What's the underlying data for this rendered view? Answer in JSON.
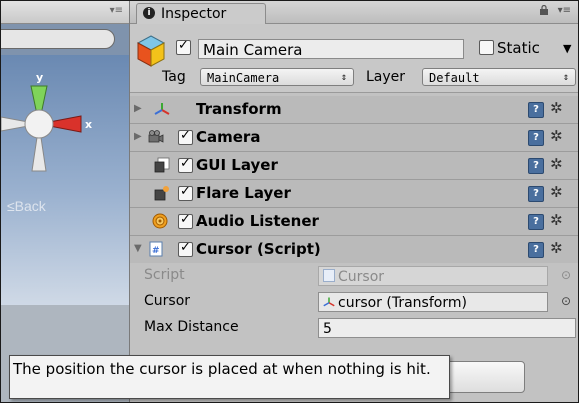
{
  "scene": {
    "menu_glyph": "▾≡",
    "back_label": "≤Back",
    "gizmo_y_label": "y",
    "gizmo_x_label": "x"
  },
  "inspector": {
    "tab_label": "Inspector",
    "tab_icon_glyph": "i",
    "menu_glyph": "▾≡",
    "object_name": "Main Camera",
    "object_enabled": true,
    "static_label": "Static",
    "static_checked": false,
    "static_arrow": "▼",
    "tag_label": "Tag",
    "tag_value": "MainCamera",
    "layer_label": "Layer",
    "layer_value": "Default",
    "dropdown_arrows": "⇕"
  },
  "components": [
    {
      "name": "Transform",
      "has_checkbox": false,
      "icon": "transform-icon"
    },
    {
      "name": "Camera",
      "has_checkbox": true,
      "icon": "camera-icon"
    },
    {
      "name": "GUI Layer",
      "has_checkbox": true,
      "icon": "gui-layer-icon"
    },
    {
      "name": "Flare Layer",
      "has_checkbox": true,
      "icon": "flare-layer-icon"
    },
    {
      "name": "Audio Listener",
      "has_checkbox": true,
      "icon": "audio-listener-icon"
    },
    {
      "name": "Cursor (Script)",
      "has_checkbox": true,
      "icon": "script-icon"
    }
  ],
  "help_glyph": "?",
  "gear_glyph": "✲",
  "script_props": {
    "script_label": "Script",
    "script_value": "Cursor",
    "cursor_label": "Cursor",
    "cursor_value": "cursor (Transform)",
    "max_distance_label": "Max Distance",
    "max_distance_value": "5",
    "object_picker_glyph": "⊙"
  },
  "tooltip": {
    "text": "The position the cursor is placed at when nothing is hit."
  },
  "colors": {
    "accent_blue": "#4a6f9e",
    "panel_bg": "#c2c2c2",
    "scene_sky": "#7f93ad"
  }
}
